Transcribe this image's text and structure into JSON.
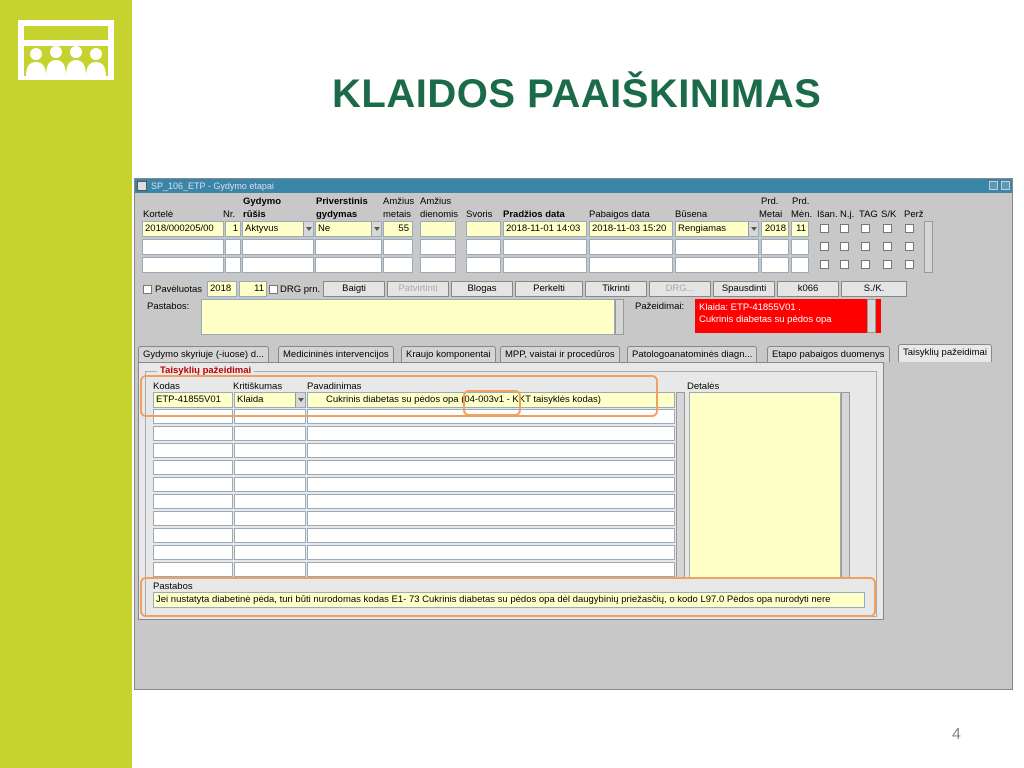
{
  "slide": {
    "title": "KLAIDOS PAAIŠKINIMAS",
    "page_number": "4",
    "sidebar_color": "#c6d22e",
    "title_color": "#1b6b4a"
  },
  "window": {
    "title": "SP_106_ETP - Gydymo etapai",
    "headers": {
      "kortele": "Kortelė",
      "nr": "Nr.",
      "gydymo": "Gydymo",
      "rusis": "rūšis",
      "priverstinis": "Priverstinis",
      "gydymas": "gydymas",
      "amzius1": "Amžius",
      "metais": "metais",
      "amzius2": "Amžius",
      "dienomis": "dienomis",
      "svoris": "Svoris",
      "pradzios": "Pradžios data",
      "pabaigos": "Pabaigos data",
      "busena": "Būsena",
      "prd1": "Prd.",
      "metai": "Metai",
      "prd2": "Prd.",
      "men": "Mėn.",
      "isan": "Išan.",
      "nj": "N.j.",
      "tag": "TAG",
      "sk": "S/K",
      "perz": "Perž"
    },
    "record": {
      "kortele": "2018/000205/00",
      "nr": "1",
      "rusis": "Aktyvus",
      "gydymas": "Ne",
      "metais": "55",
      "pradzios": "2018-11-01 14:03",
      "pabaigos": "2018-11-03 15:20",
      "busena": "Rengiamas",
      "metai": "2018",
      "men": "11"
    },
    "status_row": {
      "paveluotas": "Pavėluotas",
      "year": "2018",
      "month": "11",
      "drg_prn": "DRG prn."
    },
    "buttons": {
      "baigti": "Baigti",
      "patvirtinti": "Patvirtinti",
      "blogas": "Blogas",
      "perkelti": "Perkelti",
      "tikrinti": "Tikrinti",
      "drg": "DRG...",
      "spausdinti": "Spausdinti",
      "k066": "k066",
      "sk": "S./K."
    },
    "pastabos_label": "Pastabos:",
    "pazeidimai_label": "Pažeidimai:",
    "error_text": "Klaida: ETP-41855V01 .\nCukrinis diabetas su pėdos opa",
    "tabs": [
      "Gydymo skyriuje (-iuose) d...",
      "Medicininės intervencijos",
      "Kraujo komponentai",
      "MPP, vaistai ir procedūros",
      "Patologoanatominės diagn...",
      "Etapo pabaigos duomenys",
      "Taisyklių pažeidimai"
    ],
    "panel": {
      "group_title": "Taisyklių pažeidimai",
      "col_kodas": "Kodas",
      "col_kritiskumas": "Kritiškumas",
      "col_pavadinimas": "Pavadinimas",
      "col_detales": "Detalės",
      "row_kodas": "ETP-41855V01",
      "row_kritiskumas": "Klaida",
      "row_pavadinimas": "Cukrinis diabetas su pėdos opa (04-003v1 - KKT taisyklės kodas)",
      "pastabos_label": "Pastabos",
      "pastabos_text": "Jei nustatyta diabetinė pėda, turi būti nurodomas kodas E1- 73 Cukrinis diabetas su pėdos opa dėl daugybinių priežasčių, o kodo L97.0 Pėdos opa nurodyti nere"
    }
  }
}
